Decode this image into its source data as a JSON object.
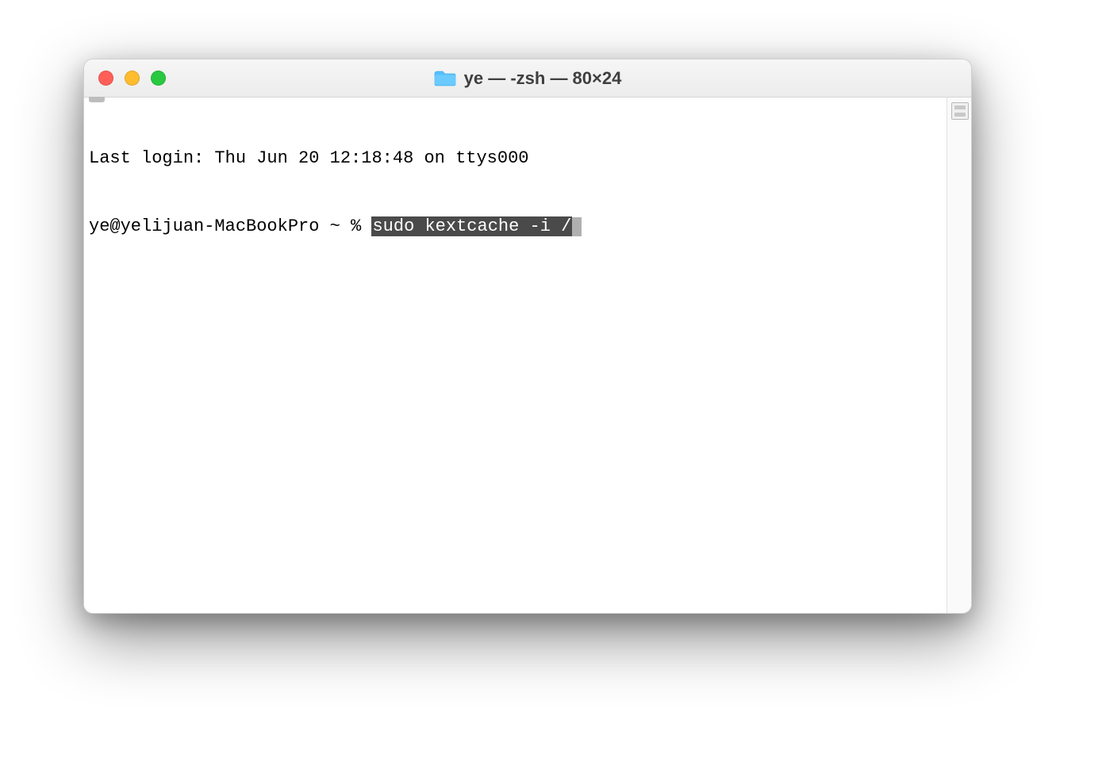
{
  "window": {
    "title": "ye — -zsh — 80×24"
  },
  "terminal": {
    "last_login": "Last login: Thu Jun 20 12:18:48 on ttys000",
    "prompt": "ye@yelijuan-MacBookPro ~ % ",
    "command": "sudo kextcache -i /"
  }
}
